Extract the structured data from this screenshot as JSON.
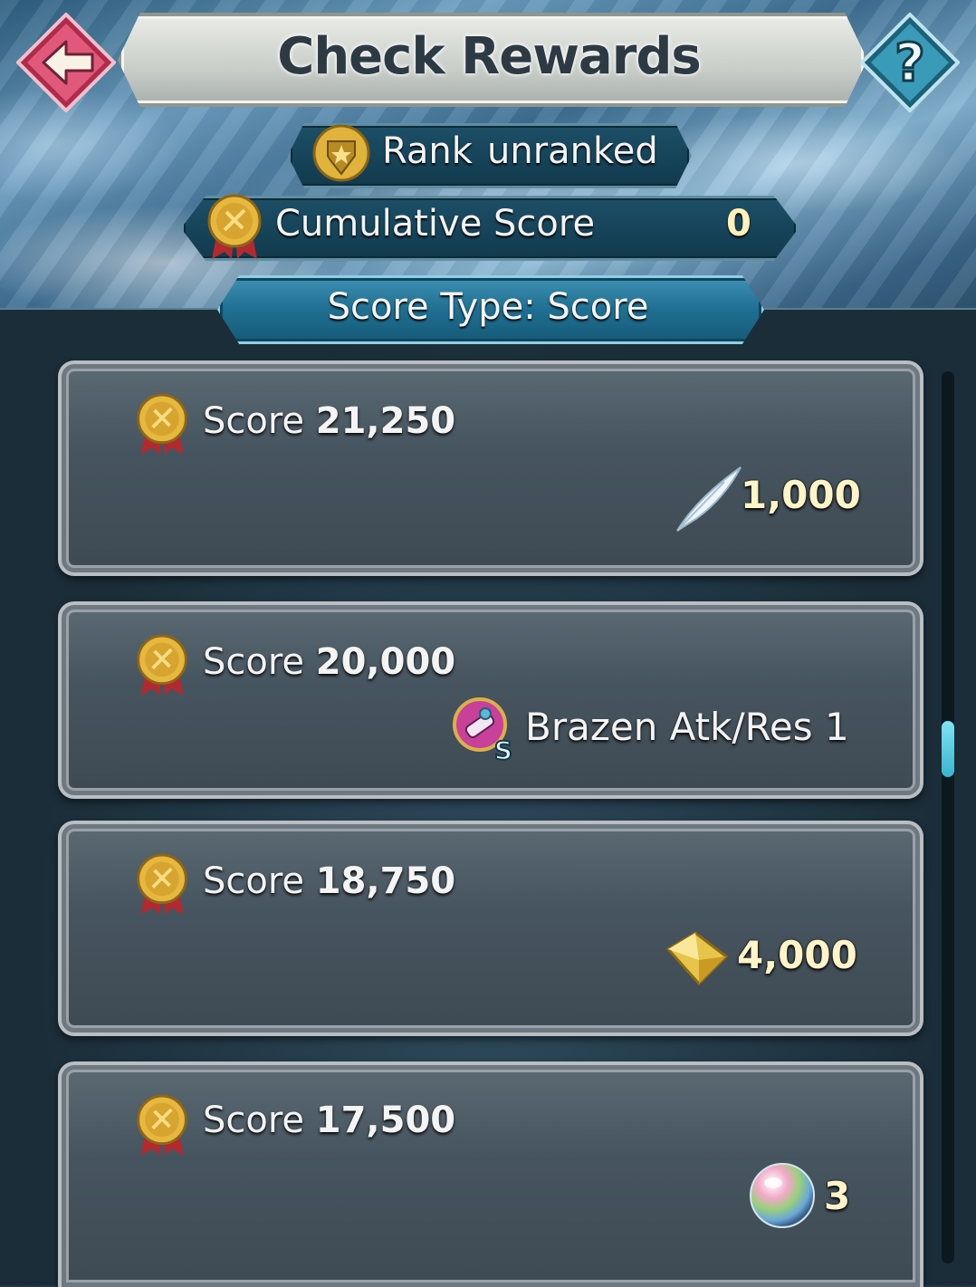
{
  "header": {
    "title": "Check Rewards",
    "back_icon": "back-arrow-icon",
    "help_label": "?"
  },
  "rank": {
    "label": "Rank",
    "value": "unranked"
  },
  "cumulative": {
    "label": "Cumulative Score",
    "value": "0"
  },
  "score_type": {
    "label": "Score Type: Score"
  },
  "rewards": [
    {
      "label": "Score",
      "score": "21,250",
      "reward_icon": "feather-icon",
      "reward_value": "1,000"
    },
    {
      "label": "Score",
      "score": "20,000",
      "reward_icon": "skill-scroll-icon",
      "reward_value": "Brazen Atk/Res 1"
    },
    {
      "label": "Score",
      "score": "18,750",
      "reward_icon": "crystal-icon",
      "reward_value": "4,000"
    },
    {
      "label": "Score",
      "score": "17,500",
      "reward_icon": "orb-icon",
      "reward_value": "3"
    }
  ],
  "colors": {
    "accent": "#3bb4cf",
    "gold": "#e2b23a",
    "back_button": "#d8486a",
    "help_button": "#2e8aa6"
  }
}
